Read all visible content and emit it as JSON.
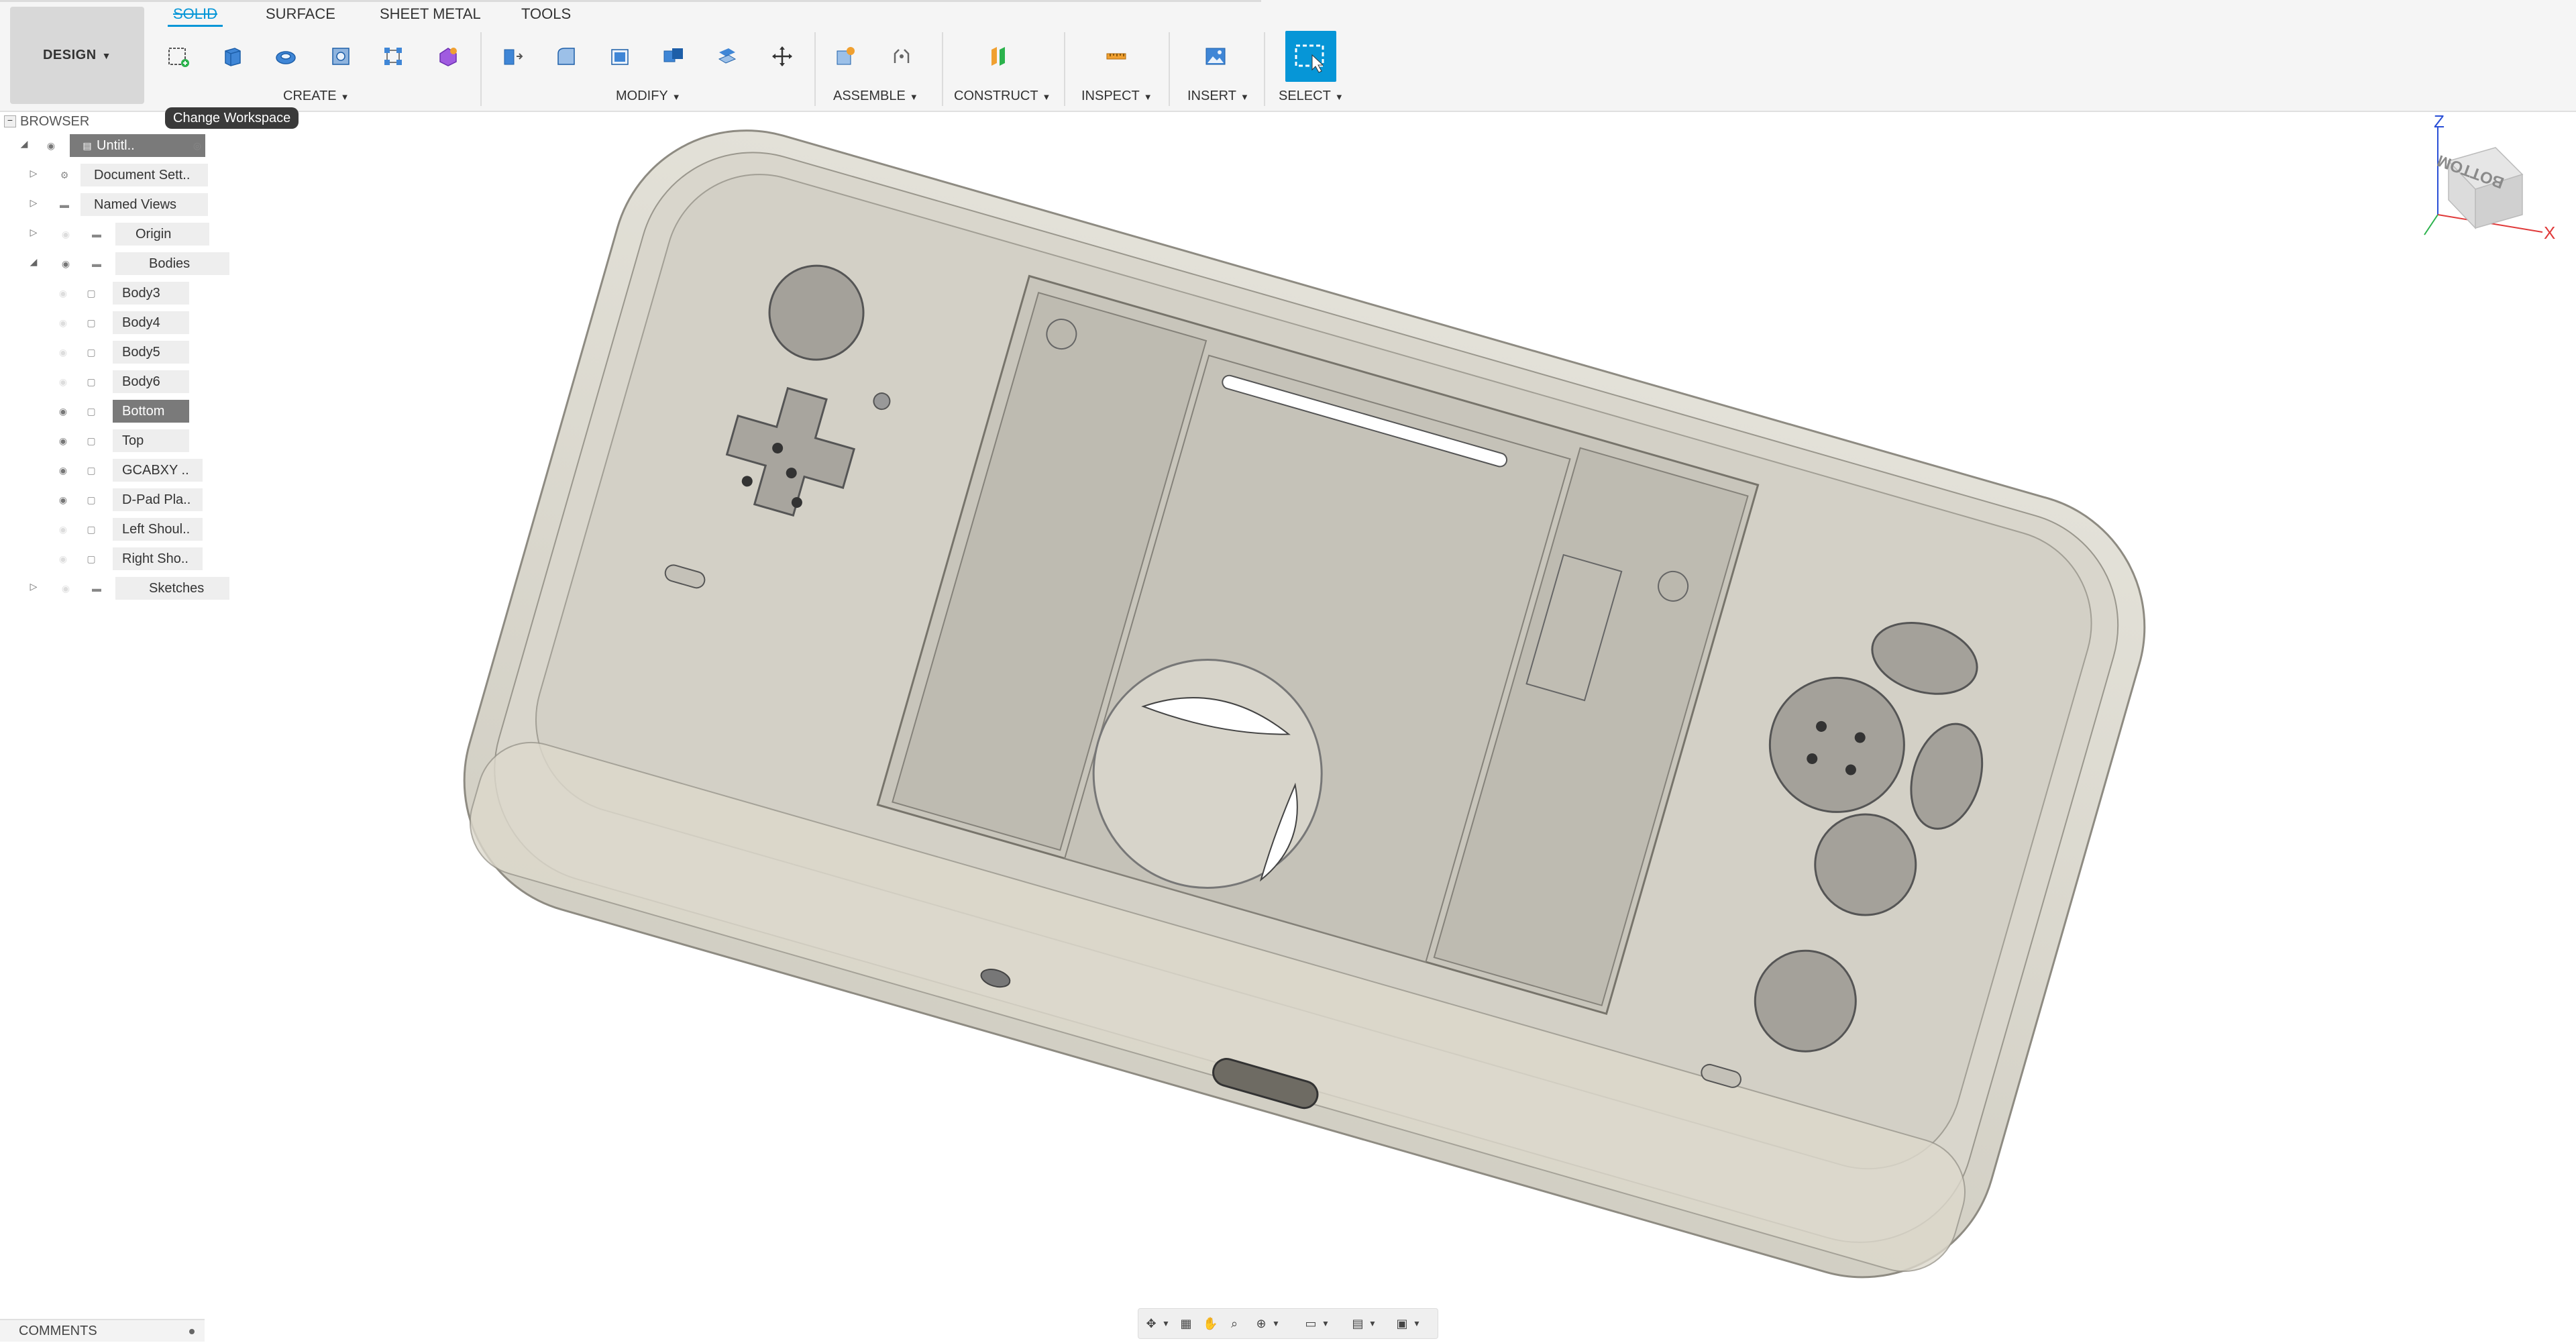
{
  "toolbar": {
    "workspace_button": "DESIGN",
    "tabs": [
      {
        "label": "SOLID",
        "active": true
      },
      {
        "label": "SURFACE",
        "active": false
      },
      {
        "label": "SHEET METAL",
        "active": false
      },
      {
        "label": "TOOLS",
        "active": false
      }
    ],
    "groups": {
      "create": "CREATE",
      "modify": "MODIFY",
      "assemble": "ASSEMBLE",
      "construct": "CONSTRUCT",
      "inspect": "INSPECT",
      "insert": "INSERT",
      "select": "SELECT"
    },
    "accent_color": "#0696d7"
  },
  "tooltip": "Change Workspace",
  "browser": {
    "title": "BROWSER",
    "items": [
      {
        "label": "Untitl..",
        "selected": true,
        "kind": "root"
      },
      {
        "label": "Document Sett..",
        "selected": false,
        "kind": "settings"
      },
      {
        "label": "Named Views",
        "selected": false,
        "kind": "folder"
      },
      {
        "label": "Origin",
        "selected": false,
        "kind": "folder"
      },
      {
        "label": "Bodies",
        "selected": false,
        "kind": "folder"
      },
      {
        "label": "Body3",
        "selected": false,
        "kind": "body"
      },
      {
        "label": "Body4",
        "selected": false,
        "kind": "body"
      },
      {
        "label": "Body5",
        "selected": false,
        "kind": "body"
      },
      {
        "label": "Body6",
        "selected": false,
        "kind": "body"
      },
      {
        "label": "Bottom",
        "selected": true,
        "kind": "body"
      },
      {
        "label": "Top",
        "selected": false,
        "kind": "body"
      },
      {
        "label": "GCABXY ..",
        "selected": false,
        "kind": "body"
      },
      {
        "label": "D-Pad Pla..",
        "selected": false,
        "kind": "body"
      },
      {
        "label": "Left Shoul..",
        "selected": false,
        "kind": "body"
      },
      {
        "label": "Right Sho..",
        "selected": false,
        "kind": "body"
      },
      {
        "label": "Sketches",
        "selected": false,
        "kind": "folder"
      }
    ]
  },
  "viewcube": {
    "face_label": "BOTTOM",
    "axis_z": "Z",
    "axis_x": "X"
  },
  "comments": {
    "label": "COMMENTS"
  }
}
